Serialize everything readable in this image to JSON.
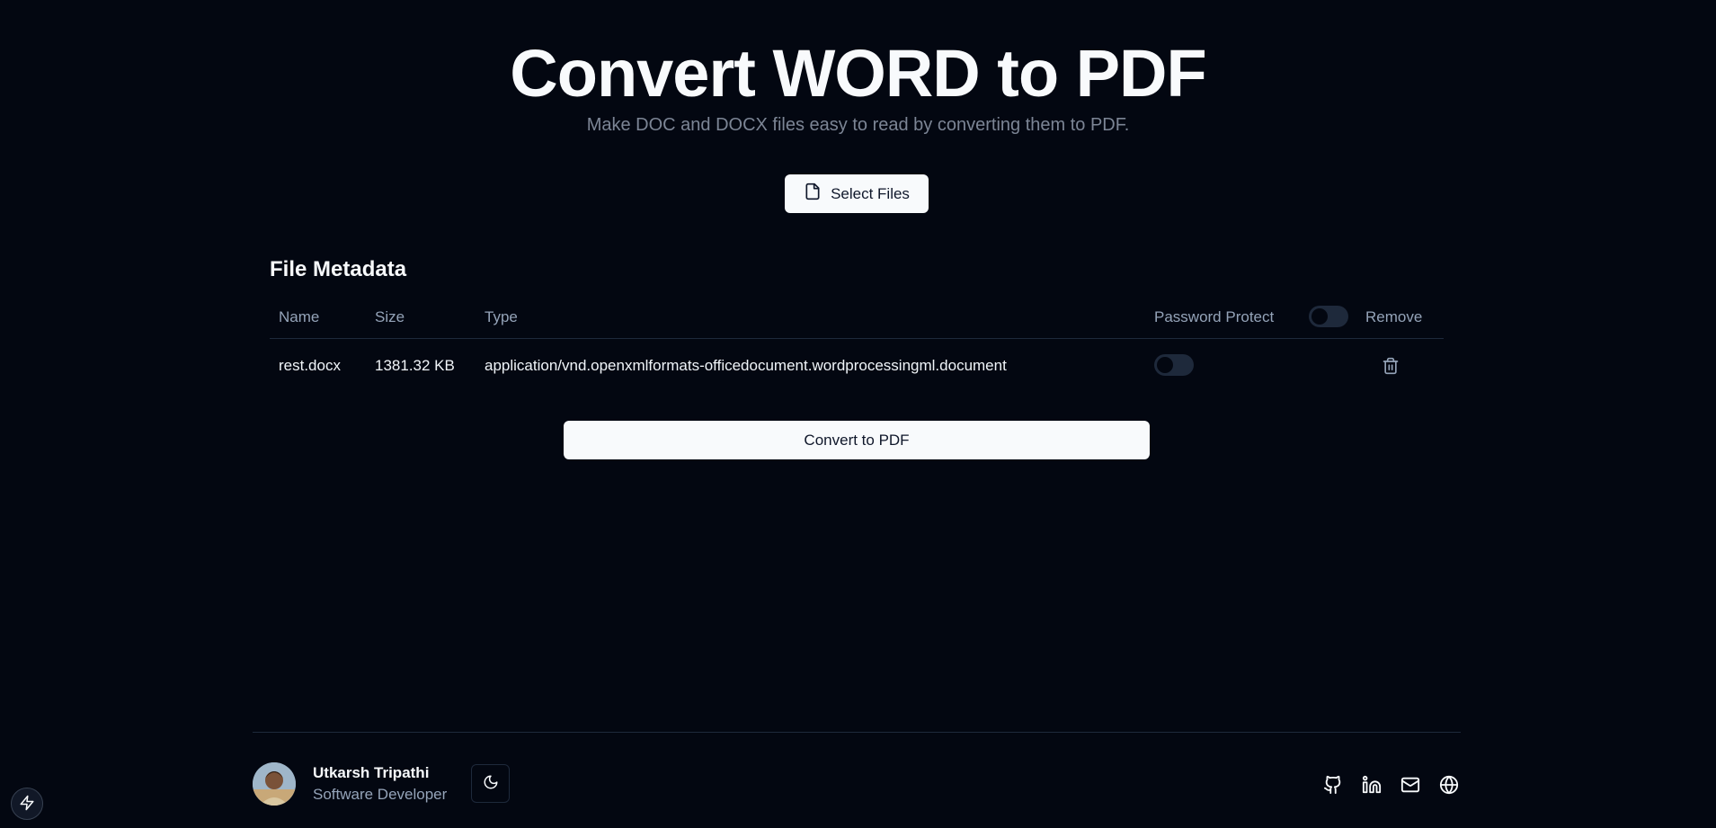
{
  "hero": {
    "title": "Convert WORD to PDF",
    "subtitle": "Make DOC and DOCX files easy to read by converting them to PDF."
  },
  "upload": {
    "select_label": "Select Files",
    "icon": "file-icon"
  },
  "metadata": {
    "title": "File Metadata",
    "columns": {
      "name": "Name",
      "size": "Size",
      "type": "Type",
      "password": "Password Protect",
      "remove": "Remove"
    },
    "rows": [
      {
        "name": "rest.docx",
        "size": "1381.32 KB",
        "type": "application/vnd.openxmlformats-officedocument.wordprocessingml.document",
        "password_protect": false
      }
    ],
    "password_all": false
  },
  "actions": {
    "convert_label": "Convert to PDF"
  },
  "footer": {
    "author_name": "Utkarsh Tripathi",
    "author_role": "Software Developer",
    "theme_icon": "moon-icon",
    "social_icons": [
      "github-icon",
      "linkedin-icon",
      "mail-icon",
      "globe-icon"
    ]
  },
  "colors": {
    "background": "#030711",
    "foreground": "#f8fafc",
    "muted": "#94a3b8",
    "border": "#1e293b"
  }
}
